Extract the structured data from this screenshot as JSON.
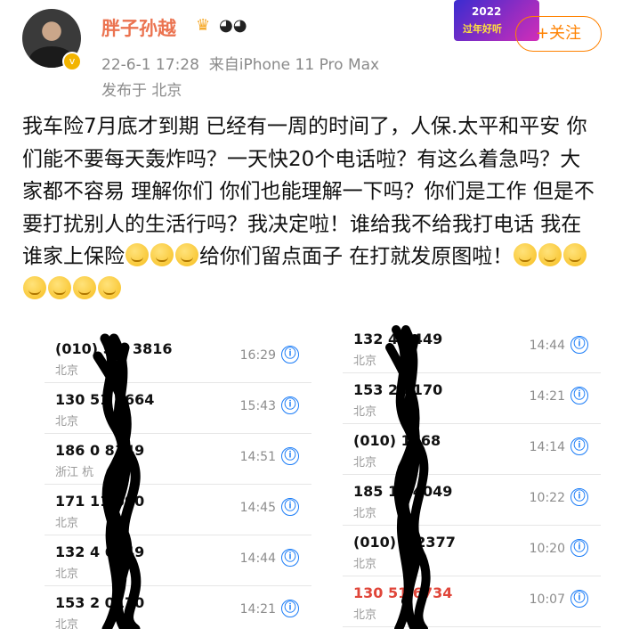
{
  "header": {
    "author_name": "胖子孙越",
    "timestamp": "22-6-1 17:28",
    "device": "来自iPhone 11 Pro Max",
    "location": "发布于 北京",
    "follow_label": "+关注",
    "banner_year": "2022",
    "banner_text": "过年好听"
  },
  "post": {
    "text": "我车险7月底才到期 已经有一周的时间了，人保.太平和平安 你们能不要每天轰炸吗？一天快20个电话啦？有这么着急吗？大家都不容易 理解你们 你们也能理解一下吗？你们是工作 但是不要打扰别人的生活行吗？我决定啦！谁给我不给我打电话 我在谁家上保险",
    "text_end_1": "给你们留点面子 在打就发原图啦！"
  },
  "calls_left": [
    {
      "number": "(010) 5      9 3816",
      "location": "北京",
      "time": "16:29",
      "missed": false
    },
    {
      "number": "130 51      5664",
      "location": "北京",
      "time": "15:43",
      "missed": false
    },
    {
      "number": "186 0      8149",
      "location": "浙江 杭",
      "time": "14:51",
      "missed": false
    },
    {
      "number": "171 11      690",
      "location": "北京",
      "time": "14:45",
      "missed": false
    },
    {
      "number": "132 4      6449",
      "location": "北京",
      "time": "14:44",
      "missed": false
    },
    {
      "number": "153 2      0170",
      "location": "北京",
      "time": "14:21",
      "missed": false
    }
  ],
  "calls_right": [
    {
      "number": "132 4      6449",
      "location": "北京",
      "time": "14:44",
      "missed": false
    },
    {
      "number": "153 2      0170",
      "location": "北京",
      "time": "14:21",
      "missed": false
    },
    {
      "number": "(010)      1768",
      "location": "北京",
      "time": "14:14",
      "missed": false
    },
    {
      "number": "185 15      4049",
      "location": "北京",
      "time": "10:22",
      "missed": false
    },
    {
      "number": "(010) 5      2377",
      "location": "北京",
      "time": "10:20",
      "missed": false
    },
    {
      "number": "130 51      6734",
      "location": "北京",
      "time": "10:07",
      "missed": true
    }
  ],
  "icons": {
    "info": "ⓘ",
    "info_icon_name": "info-circle-icon",
    "emoji_icon_name": "grinning-face-icon"
  },
  "colors": {
    "author": "#eb7350",
    "follow": "#ff8200",
    "info": "#1a7cf7",
    "missed": "#e0463a"
  }
}
